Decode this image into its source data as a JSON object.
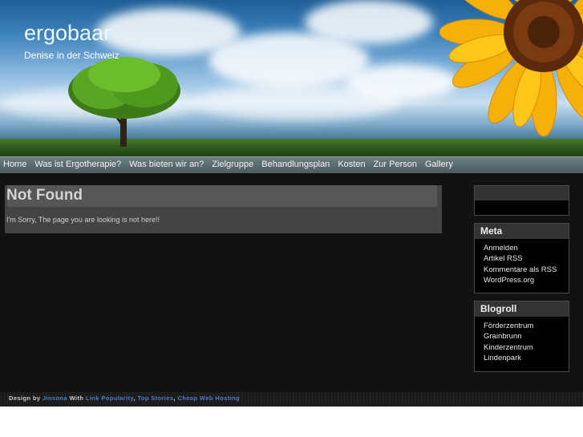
{
  "header": {
    "title": "ergobaar",
    "tagline": "Denise in der Schweiz"
  },
  "nav": {
    "items": [
      {
        "label": "Home"
      },
      {
        "label": "Was ist Ergotherapie?"
      },
      {
        "label": "Was bieten wir an?"
      },
      {
        "label": "Zielgruppe"
      },
      {
        "label": "Behandlungsplan"
      },
      {
        "label": "Kosten"
      },
      {
        "label": "Zur Person"
      },
      {
        "label": "Gallery"
      }
    ]
  },
  "main": {
    "title": "Not Found",
    "message": "I'm Sorry, The page you are looking is not here!!"
  },
  "sidebar": {
    "meta": {
      "title": "Meta",
      "items": [
        "Anmelden",
        "Artikel RSS",
        "Kommentare als RSS",
        "WordPress.org"
      ]
    },
    "blogroll": {
      "title": "Blogroll",
      "items": [
        "Förderzentrum",
        "Grainbrunn",
        "Kinderzentrum",
        "Lindenpark"
      ]
    }
  },
  "footer": {
    "prefix": "Design by",
    "designer": "Jinsona",
    "with": "With",
    "link1": "Link Popularity",
    "sep1": ",",
    "link2": "Top Stories",
    "sep2": ",",
    "link3": "Cheap Web Hosting"
  },
  "colors": {
    "background": "#121212",
    "content_box": "#444444",
    "widget_header": "#333333",
    "footer_link": "#4a7fd0"
  }
}
